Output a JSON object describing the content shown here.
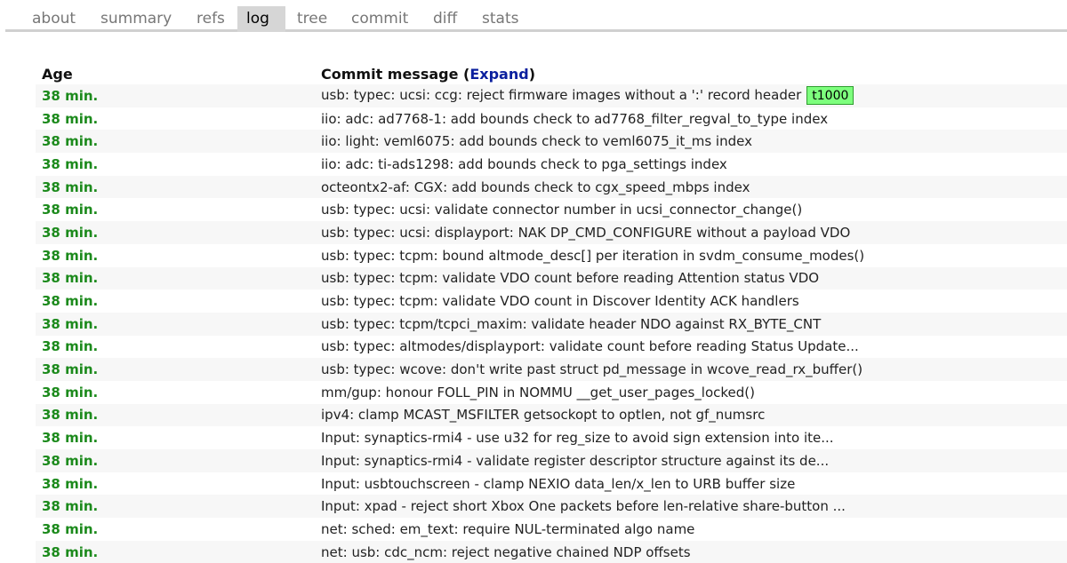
{
  "tabs": [
    {
      "label": "about"
    },
    {
      "label": "summary"
    },
    {
      "label": "refs"
    },
    {
      "label": "log"
    },
    {
      "label": "tree"
    },
    {
      "label": "commit"
    },
    {
      "label": "diff"
    },
    {
      "label": "stats"
    }
  ],
  "active_tab": "log",
  "log": {
    "col_age": "Age",
    "col_message": "Commit message",
    "expand_open": "(",
    "expand_label": "Expand",
    "expand_close": ")",
    "rows": [
      {
        "age": "38 min.",
        "message": "usb: typec: ucsi: ccg: reject firmware images without a ':' record header",
        "tag": "t1000"
      },
      {
        "age": "38 min.",
        "message": "iio: adc: ad7768-1: add bounds check to ad7768_filter_regval_to_type index"
      },
      {
        "age": "38 min.",
        "message": "iio: light: veml6075: add bounds check to veml6075_it_ms index"
      },
      {
        "age": "38 min.",
        "message": "iio: adc: ti-ads1298: add bounds check to pga_settings index"
      },
      {
        "age": "38 min.",
        "message": "octeontx2-af: CGX: add bounds check to cgx_speed_mbps index"
      },
      {
        "age": "38 min.",
        "message": "usb: typec: ucsi: validate connector number in ucsi_connector_change()"
      },
      {
        "age": "38 min.",
        "message": "usb: typec: ucsi: displayport: NAK DP_CMD_CONFIGURE without a payload VDO"
      },
      {
        "age": "38 min.",
        "message": "usb: typec: tcpm: bound altmode_desc[] per iteration in svdm_consume_modes()"
      },
      {
        "age": "38 min.",
        "message": "usb: typec: tcpm: validate VDO count before reading Attention status VDO"
      },
      {
        "age": "38 min.",
        "message": "usb: typec: tcpm: validate VDO count in Discover Identity ACK handlers"
      },
      {
        "age": "38 min.",
        "message": "usb: typec: tcpm/tcpci_maxim: validate header NDO against RX_BYTE_CNT"
      },
      {
        "age": "38 min.",
        "message": "usb: typec: altmodes/displayport: validate count before reading Status Update..."
      },
      {
        "age": "38 min.",
        "message": "usb: typec: wcove: don't write past struct pd_message in wcove_read_rx_buffer()"
      },
      {
        "age": "38 min.",
        "message": "mm/gup: honour FOLL_PIN in NOMMU __get_user_pages_locked()"
      },
      {
        "age": "38 min.",
        "message": "ipv4: clamp MCAST_MSFILTER getsockopt to optlen, not gf_numsrc"
      },
      {
        "age": "38 min.",
        "message": "Input: synaptics-rmi4 - use u32 for reg_size to avoid sign extension into ite..."
      },
      {
        "age": "38 min.",
        "message": "Input: synaptics-rmi4 - validate register descriptor structure against its de..."
      },
      {
        "age": "38 min.",
        "message": "Input: usbtouchscreen - clamp NEXIO data_len/x_len to URB buffer size"
      },
      {
        "age": "38 min.",
        "message": "Input: xpad - reject short Xbox One packets before len-relative share-button ..."
      },
      {
        "age": "38 min.",
        "message": "net: sched: em_text: require NUL-terminated algo name"
      },
      {
        "age": "38 min.",
        "message": "net: usb: cdc_ncm: reject negative chained NDP offsets"
      }
    ]
  },
  "colors": {
    "age_green": "#1c8a1c",
    "link_blue": "#0a1f9e",
    "tag_bg": "#7dff7d",
    "tag_border": "#2f9e2f",
    "active_tab_bg": "#d6d6d6"
  }
}
